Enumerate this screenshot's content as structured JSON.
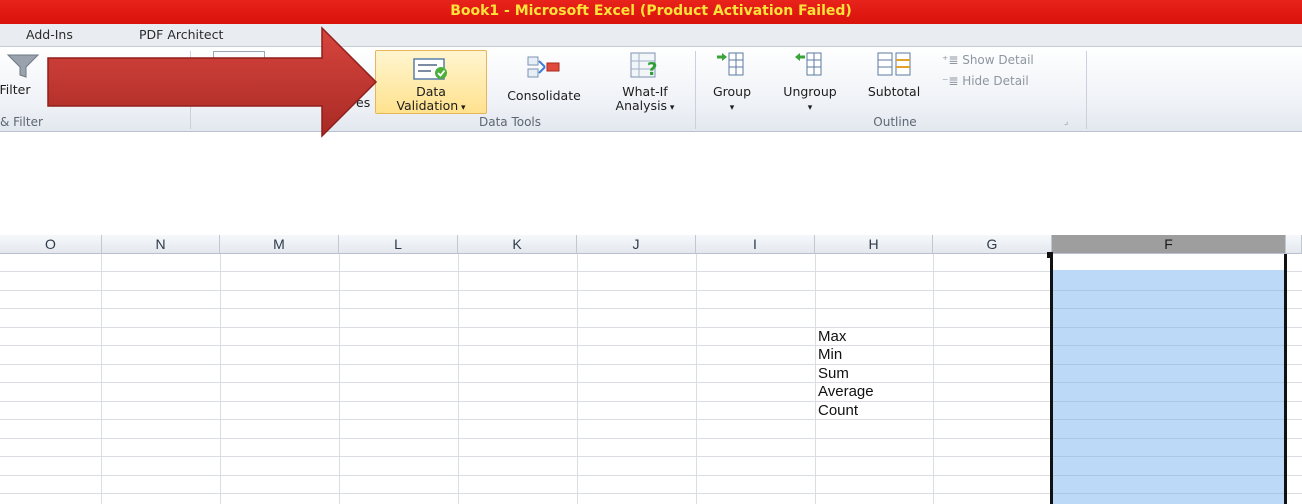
{
  "window": {
    "title": "Book1  -  Microsoft Excel (Product Activation Failed)"
  },
  "tabs": [
    "Add-Ins",
    "PDF Architect"
  ],
  "ribbon": {
    "sort_filter": {
      "filter_label": "Filter",
      "group_label": "& Filter"
    },
    "data_tools": {
      "partial_label": "es",
      "data_validation": {
        "line1": "Data",
        "line2": "Validation"
      },
      "consolidate": "Consolidate",
      "whatif": {
        "line1": "What-If",
        "line2": "Analysis"
      },
      "group_label": "Data Tools"
    },
    "outline": {
      "group": "Group",
      "ungroup": "Ungroup",
      "subtotal": "Subtotal",
      "show_detail": "Show Detail",
      "hide_detail": "Hide Detail",
      "group_label": "Outline"
    }
  },
  "columns": [
    "O",
    "N",
    "M",
    "L",
    "K",
    "J",
    "I",
    "H",
    "G",
    "F"
  ],
  "selected_column": "F",
  "cells": {
    "h1": "Max",
    "h2": "Min",
    "h3": "Sum",
    "h4": "Average",
    "h5": "Count"
  },
  "colors": {
    "title_bar": "#e0170f",
    "title_text": "#ffe23a",
    "arrow": "#c8302a",
    "selection_fill": "#bcd9f7"
  }
}
